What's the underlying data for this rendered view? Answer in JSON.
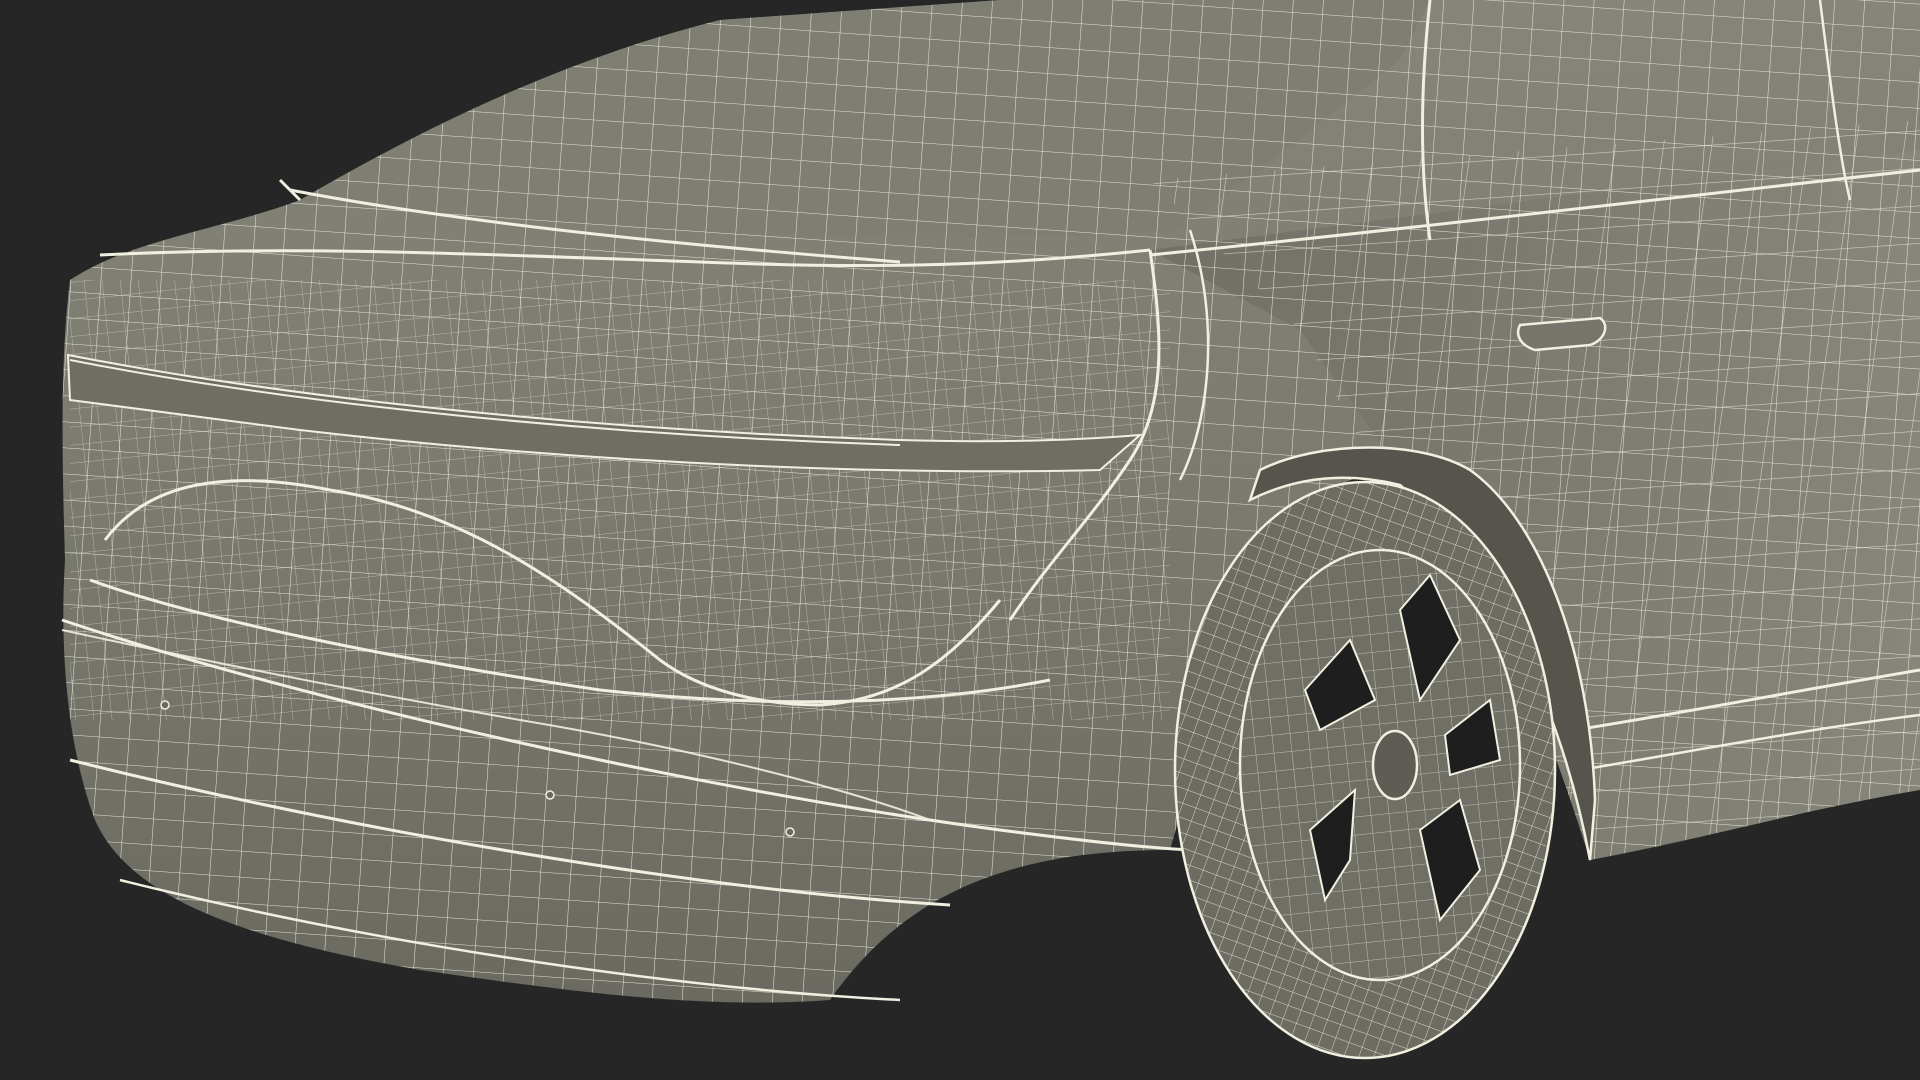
{
  "scene": {
    "subject": "car-rear-wireframe",
    "colors": {
      "background": "#262626",
      "body_fill": "#7b7b70",
      "body_dark": "#5f5f56",
      "body_light": "#8d8d80",
      "wire": "#f0efe0",
      "tire": "#6c6c63",
      "rim_dark": "#1e1e1e"
    }
  }
}
